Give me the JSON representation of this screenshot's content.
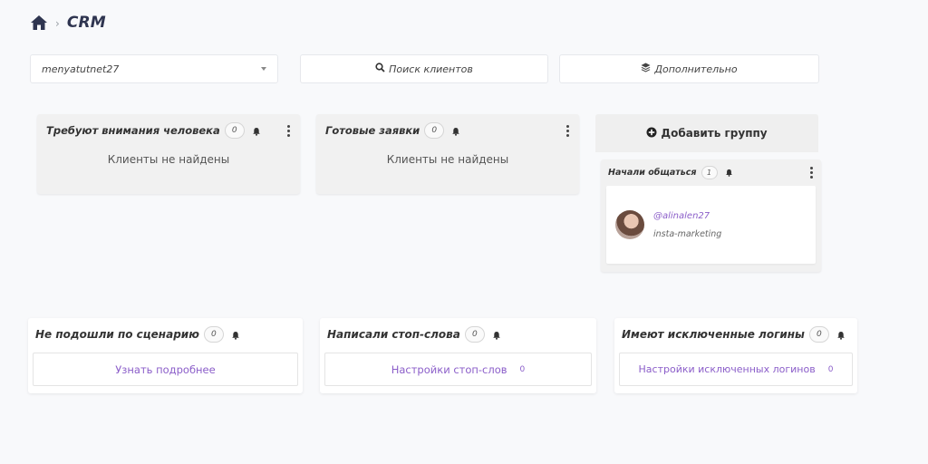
{
  "breadcrumb": {
    "title": "CRM"
  },
  "account_select": {
    "value": "menyatutnet27"
  },
  "search_button": {
    "label": "Поиск клиентов"
  },
  "more_button": {
    "label": "Дополнительно"
  },
  "columns": [
    {
      "title": "Требуют внимания человека",
      "count": "0",
      "empty": "Клиенты не найдены"
    },
    {
      "title": "Готовые заявки",
      "count": "0",
      "empty": "Клиенты не найдены"
    },
    {
      "title": "Начали общаться",
      "count": "1",
      "client": {
        "handle": "@alinalen27",
        "tag": "insta-marketing"
      }
    }
  ],
  "add_group": {
    "label": "Добавить группу"
  },
  "bottom_cards": [
    {
      "title": "Не подошли по сценарию",
      "count": "0",
      "link": "Узнать подробнее",
      "link_count": ""
    },
    {
      "title": "Написали стоп-слова",
      "count": "0",
      "link": "Настройки стоп-слов",
      "link_count": "0"
    },
    {
      "title": "Имеют исключенные логины",
      "count": "0",
      "link": "Настройки исключенных логинов",
      "link_count": "0"
    }
  ],
  "colors": {
    "accent": "#8b5ec9",
    "nav": "#2f3550",
    "column_bg": "#f1f1f1"
  },
  "icons": [
    "home-icon",
    "chevron-right-icon",
    "chevron-down-icon",
    "search-icon",
    "layers-icon",
    "plus-circle-icon",
    "bell-icon",
    "kebab-icon"
  ]
}
